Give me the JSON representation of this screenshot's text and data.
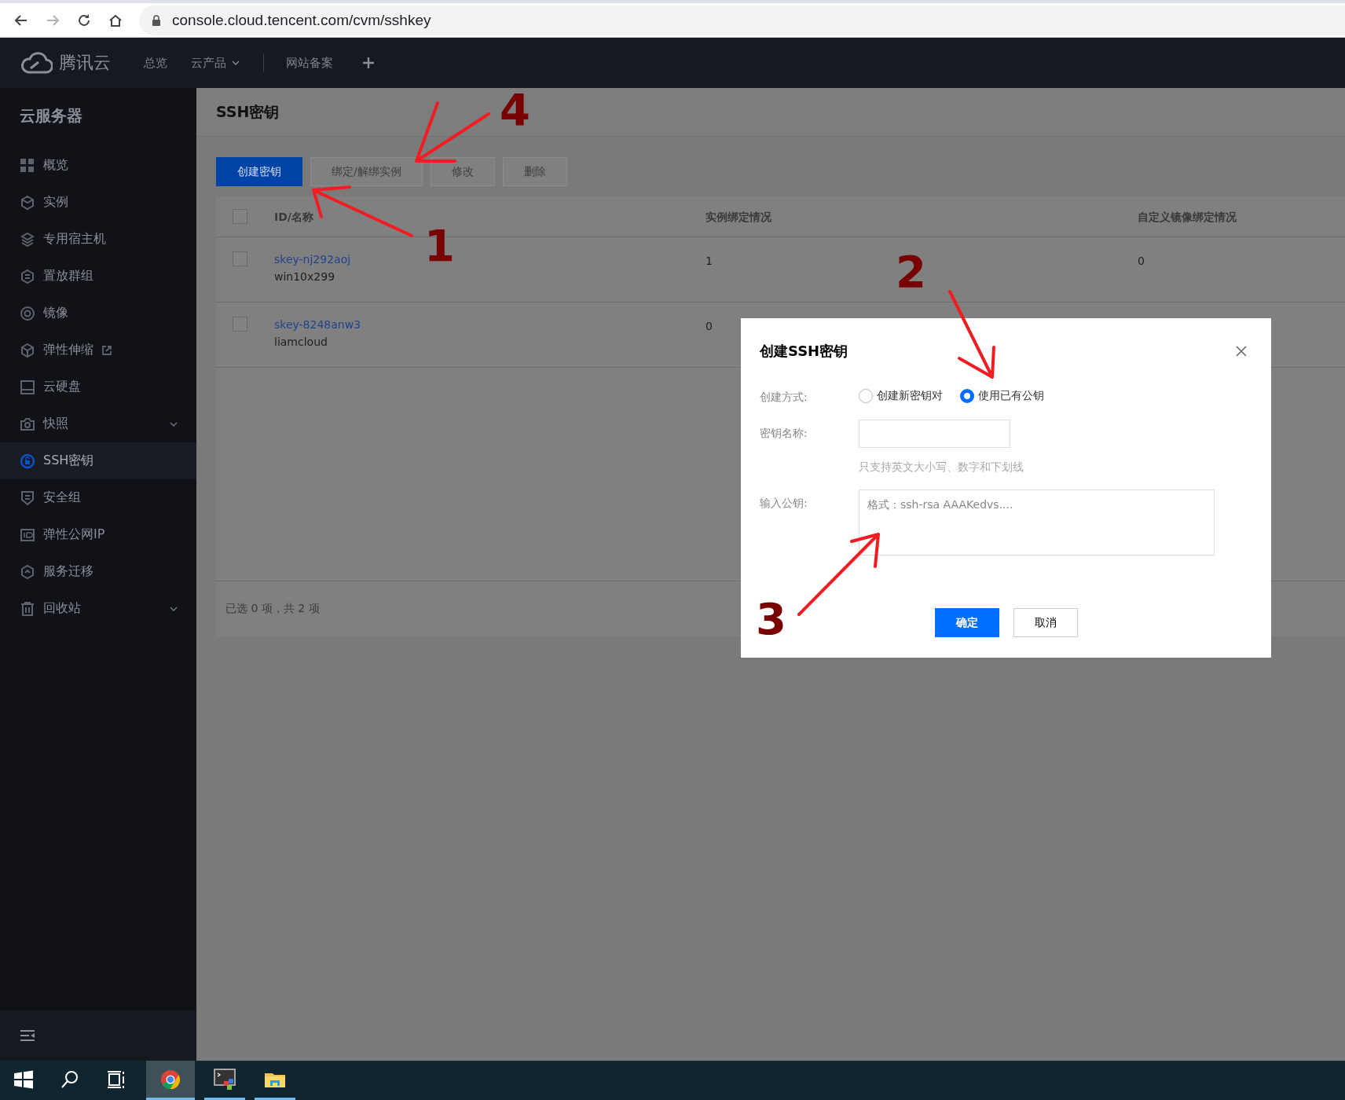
{
  "browser": {
    "buttons": [
      {
        "kind": "back",
        "disabled": false
      },
      {
        "kind": "forward",
        "disabled": true
      },
      {
        "kind": "reload",
        "disabled": false
      },
      {
        "kind": "home",
        "disabled": false
      }
    ],
    "url": "console.cloud.tencent.com/cvm/sshkey"
  },
  "topnav": {
    "brand": "腾讯云",
    "items": [
      {
        "label": "总览",
        "dropdown": false
      },
      {
        "label": "云产品",
        "dropdown": true
      },
      {
        "label": "网站备案",
        "dropdown": false
      }
    ]
  },
  "sidebar": {
    "title": "云服务器",
    "items": [
      {
        "label": "概览",
        "selected": false,
        "expandable": false,
        "external": false
      },
      {
        "label": "实例",
        "selected": false,
        "expandable": false,
        "external": false
      },
      {
        "label": "专用宿主机",
        "selected": false,
        "expandable": false,
        "external": false
      },
      {
        "label": "置放群组",
        "selected": false,
        "expandable": false,
        "external": false
      },
      {
        "label": "镜像",
        "selected": false,
        "expandable": false,
        "external": false
      },
      {
        "label": "弹性伸缩",
        "selected": false,
        "expandable": false,
        "external": true
      },
      {
        "label": "云硬盘",
        "selected": false,
        "expandable": false,
        "external": false
      },
      {
        "label": "快照",
        "selected": false,
        "expandable": true,
        "external": false
      },
      {
        "label": "SSH密钥",
        "selected": true,
        "expandable": false,
        "external": false
      },
      {
        "label": "安全组",
        "selected": false,
        "expandable": false,
        "external": false
      },
      {
        "label": "弹性公网IP",
        "selected": false,
        "expandable": false,
        "external": false
      },
      {
        "label": "服务迁移",
        "selected": false,
        "expandable": false,
        "external": false
      },
      {
        "label": "回收站",
        "selected": false,
        "expandable": true,
        "external": false
      }
    ]
  },
  "page": {
    "title": "SSH密钥"
  },
  "toolbar": {
    "buttons": [
      {
        "label": "创建密钥",
        "kind": "primary",
        "disabled": false
      },
      {
        "label": "绑定/解绑实例",
        "kind": "default",
        "disabled": true
      },
      {
        "label": "修改",
        "kind": "default",
        "disabled": true
      },
      {
        "label": "删除",
        "kind": "default",
        "disabled": true
      }
    ]
  },
  "table": {
    "header_checked": false,
    "columns": [
      "ID/名称",
      "实例绑定情况",
      "自定义镜像绑定情况"
    ],
    "rows": [
      {
        "checked": false,
        "id": "skey-nj292aoj",
        "name": "win10x299",
        "instances": "1",
        "images": "0"
      },
      {
        "checked": false,
        "id": "skey-8248anw3",
        "name": "liamcloud",
        "instances": "0",
        "images": ""
      }
    ],
    "footer": "已选 0 项，共 2 项"
  },
  "dialog": {
    "title": "创建SSH密钥",
    "fields": [
      {
        "kind": "radio",
        "label": "创建方式:",
        "options": [
          {
            "label": "创建新密钥对",
            "selected": false
          },
          {
            "label": "使用已有公钥",
            "selected": true
          }
        ]
      },
      {
        "kind": "input",
        "label": "密钥名称:",
        "help": "只支持英文大小写、数字和下划线"
      },
      {
        "kind": "textarea",
        "label": "输入公钥:",
        "placeholder": "格式：ssh-rsa AAAKedvs...."
      }
    ],
    "buttons": [
      {
        "label": "确定",
        "kind": "primary"
      },
      {
        "label": "取消",
        "kind": "default"
      }
    ]
  },
  "annotations": [
    {
      "text": "1",
      "kind": "up-left"
    },
    {
      "text": "4",
      "kind": "down-left"
    },
    {
      "text": "2",
      "kind": "down"
    },
    {
      "text": "3",
      "kind": "up-right"
    }
  ],
  "taskbar": {
    "items": [
      {
        "kind": "start",
        "selected": false,
        "running": false
      },
      {
        "kind": "search",
        "selected": false,
        "running": false
      },
      {
        "kind": "taskview",
        "selected": false,
        "running": false
      },
      {
        "kind": "browser",
        "selected": true,
        "running": true
      },
      {
        "kind": "terminal",
        "selected": false,
        "running": true
      },
      {
        "kind": "folder",
        "selected": false,
        "running": true
      }
    ]
  }
}
